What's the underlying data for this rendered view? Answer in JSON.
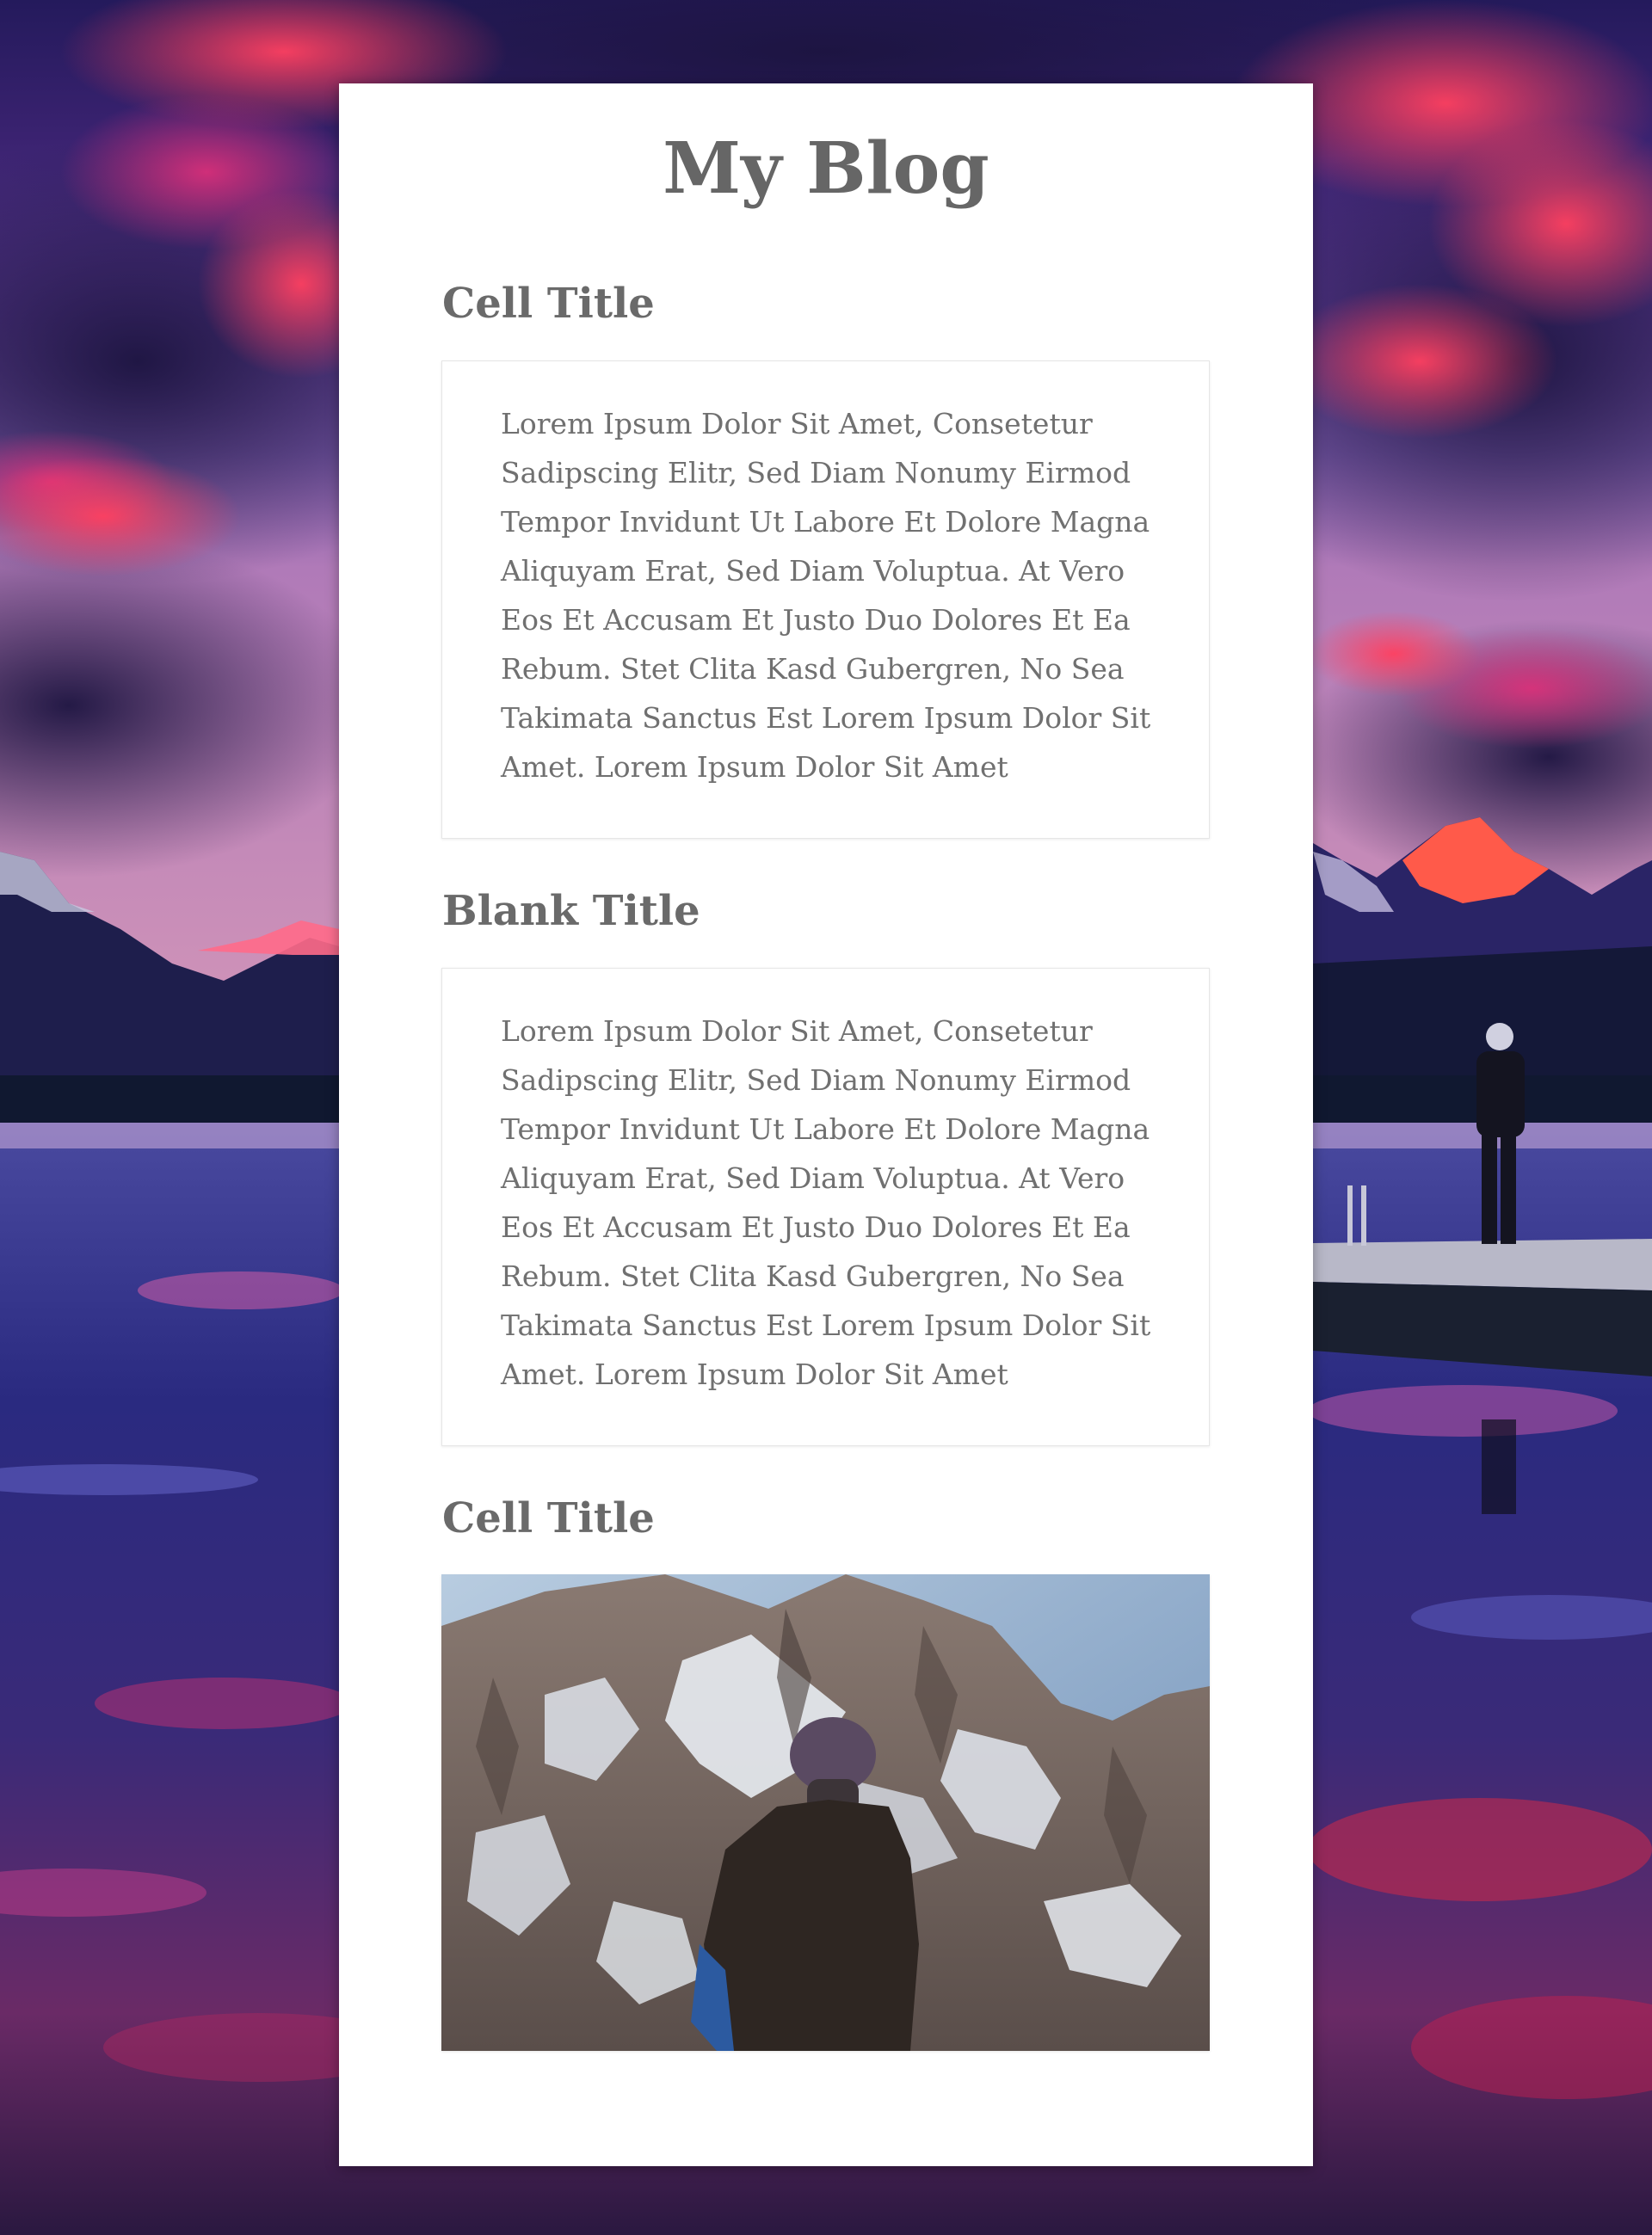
{
  "blog": {
    "title": "My Blog"
  },
  "sections": [
    {
      "title": "Cell Title",
      "body": "Lorem Ipsum Dolor Sit Amet, Consetetur Sadipscing Elitr, Sed Diam Nonumy Eirmod Tempor Invidunt Ut Labore Et Dolore Magna Aliquyam Erat, Sed Diam Voluptua. At Vero Eos Et Accusam Et Justo Duo Dolores Et Ea Rebum. Stet Clita Kasd Gubergren, No Sea Takimata Sanctus Est Lorem Ipsum Dolor Sit Amet. Lorem Ipsum Dolor Sit Amet"
    },
    {
      "title": "Blank Title",
      "body": "Lorem Ipsum Dolor Sit Amet, Consetetur Sadipscing Elitr, Sed Diam Nonumy Eirmod Tempor Invidunt Ut Labore Et Dolore Magna Aliquyam Erat, Sed Diam Voluptua. At Vero Eos Et Accusam Et Justo Duo Dolores Et Ea Rebum. Stet Clita Kasd Gubergren, No Sea Takimata Sanctus Est Lorem Ipsum Dolor Sit Amet. Lorem Ipsum Dolor Sit Amet"
    },
    {
      "title": "Cell Title",
      "image": "mountain-hiker-photo"
    }
  ],
  "background": {
    "image": "sunset-lake-mountains-photo"
  },
  "colors": {
    "card": "#ffffff",
    "heading": "#666666",
    "body_text": "#707070",
    "cell_border": "#e6e6e6"
  }
}
